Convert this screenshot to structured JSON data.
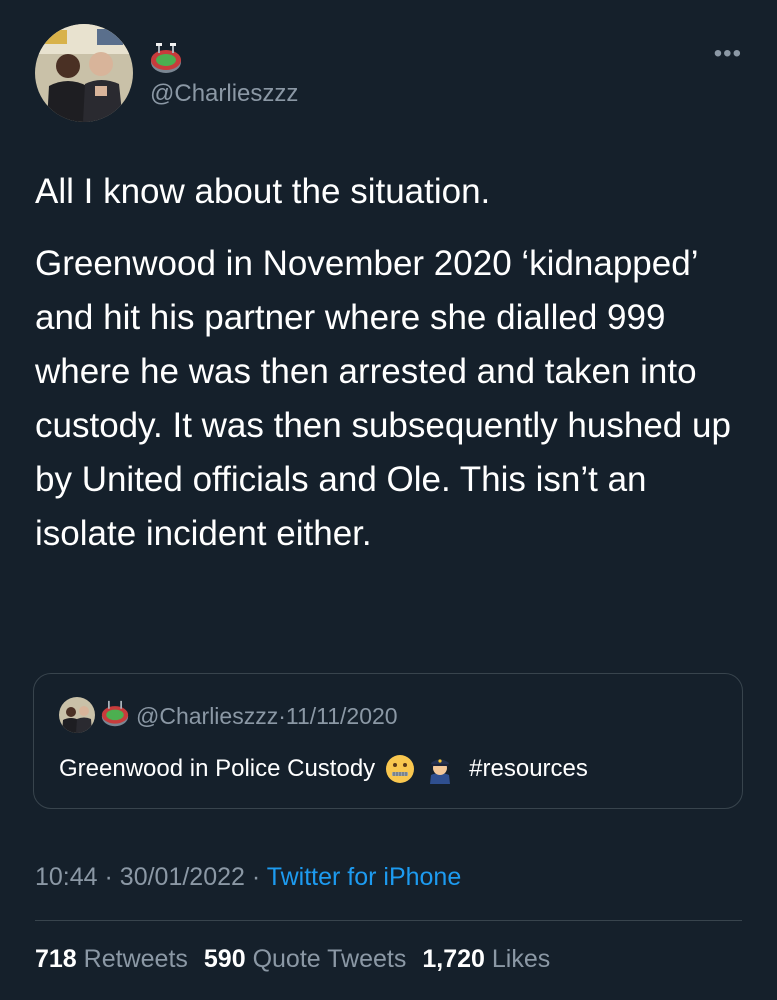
{
  "tweet": {
    "handle": "@Charlieszzz",
    "more_icon": "more-options-icon",
    "paragraphs": [
      "All I know about the situation.",
      "Greenwood in November 2020 ‘kidnapped’ and hit his partner where she dialled 999 where he was then arrested and taken into custody. It was then subsequently hushed up by United officials and Ole. This isn’t an isolate incident either."
    ],
    "time": "10:44",
    "date": "30/01/2022",
    "source": "Twitter for iPhone",
    "separator": "·"
  },
  "quoted": {
    "handle": "@Charlieszzz",
    "date": "11/11/2020",
    "text": "Greenwood in Police Custody",
    "hashtag": "#resources",
    "emojis": [
      "zipper-mouth-face-emoji",
      "police-officer-emoji"
    ]
  },
  "stats": {
    "retweets_count": "718",
    "retweets_label": "Retweets",
    "quotes_count": "590",
    "quotes_label": "Quote Tweets",
    "likes_count": "1,720",
    "likes_label": "Likes"
  },
  "colors": {
    "background": "#15202b",
    "secondary_text": "#8b98a5",
    "link": "#1d9bf0",
    "border": "#38444d"
  }
}
